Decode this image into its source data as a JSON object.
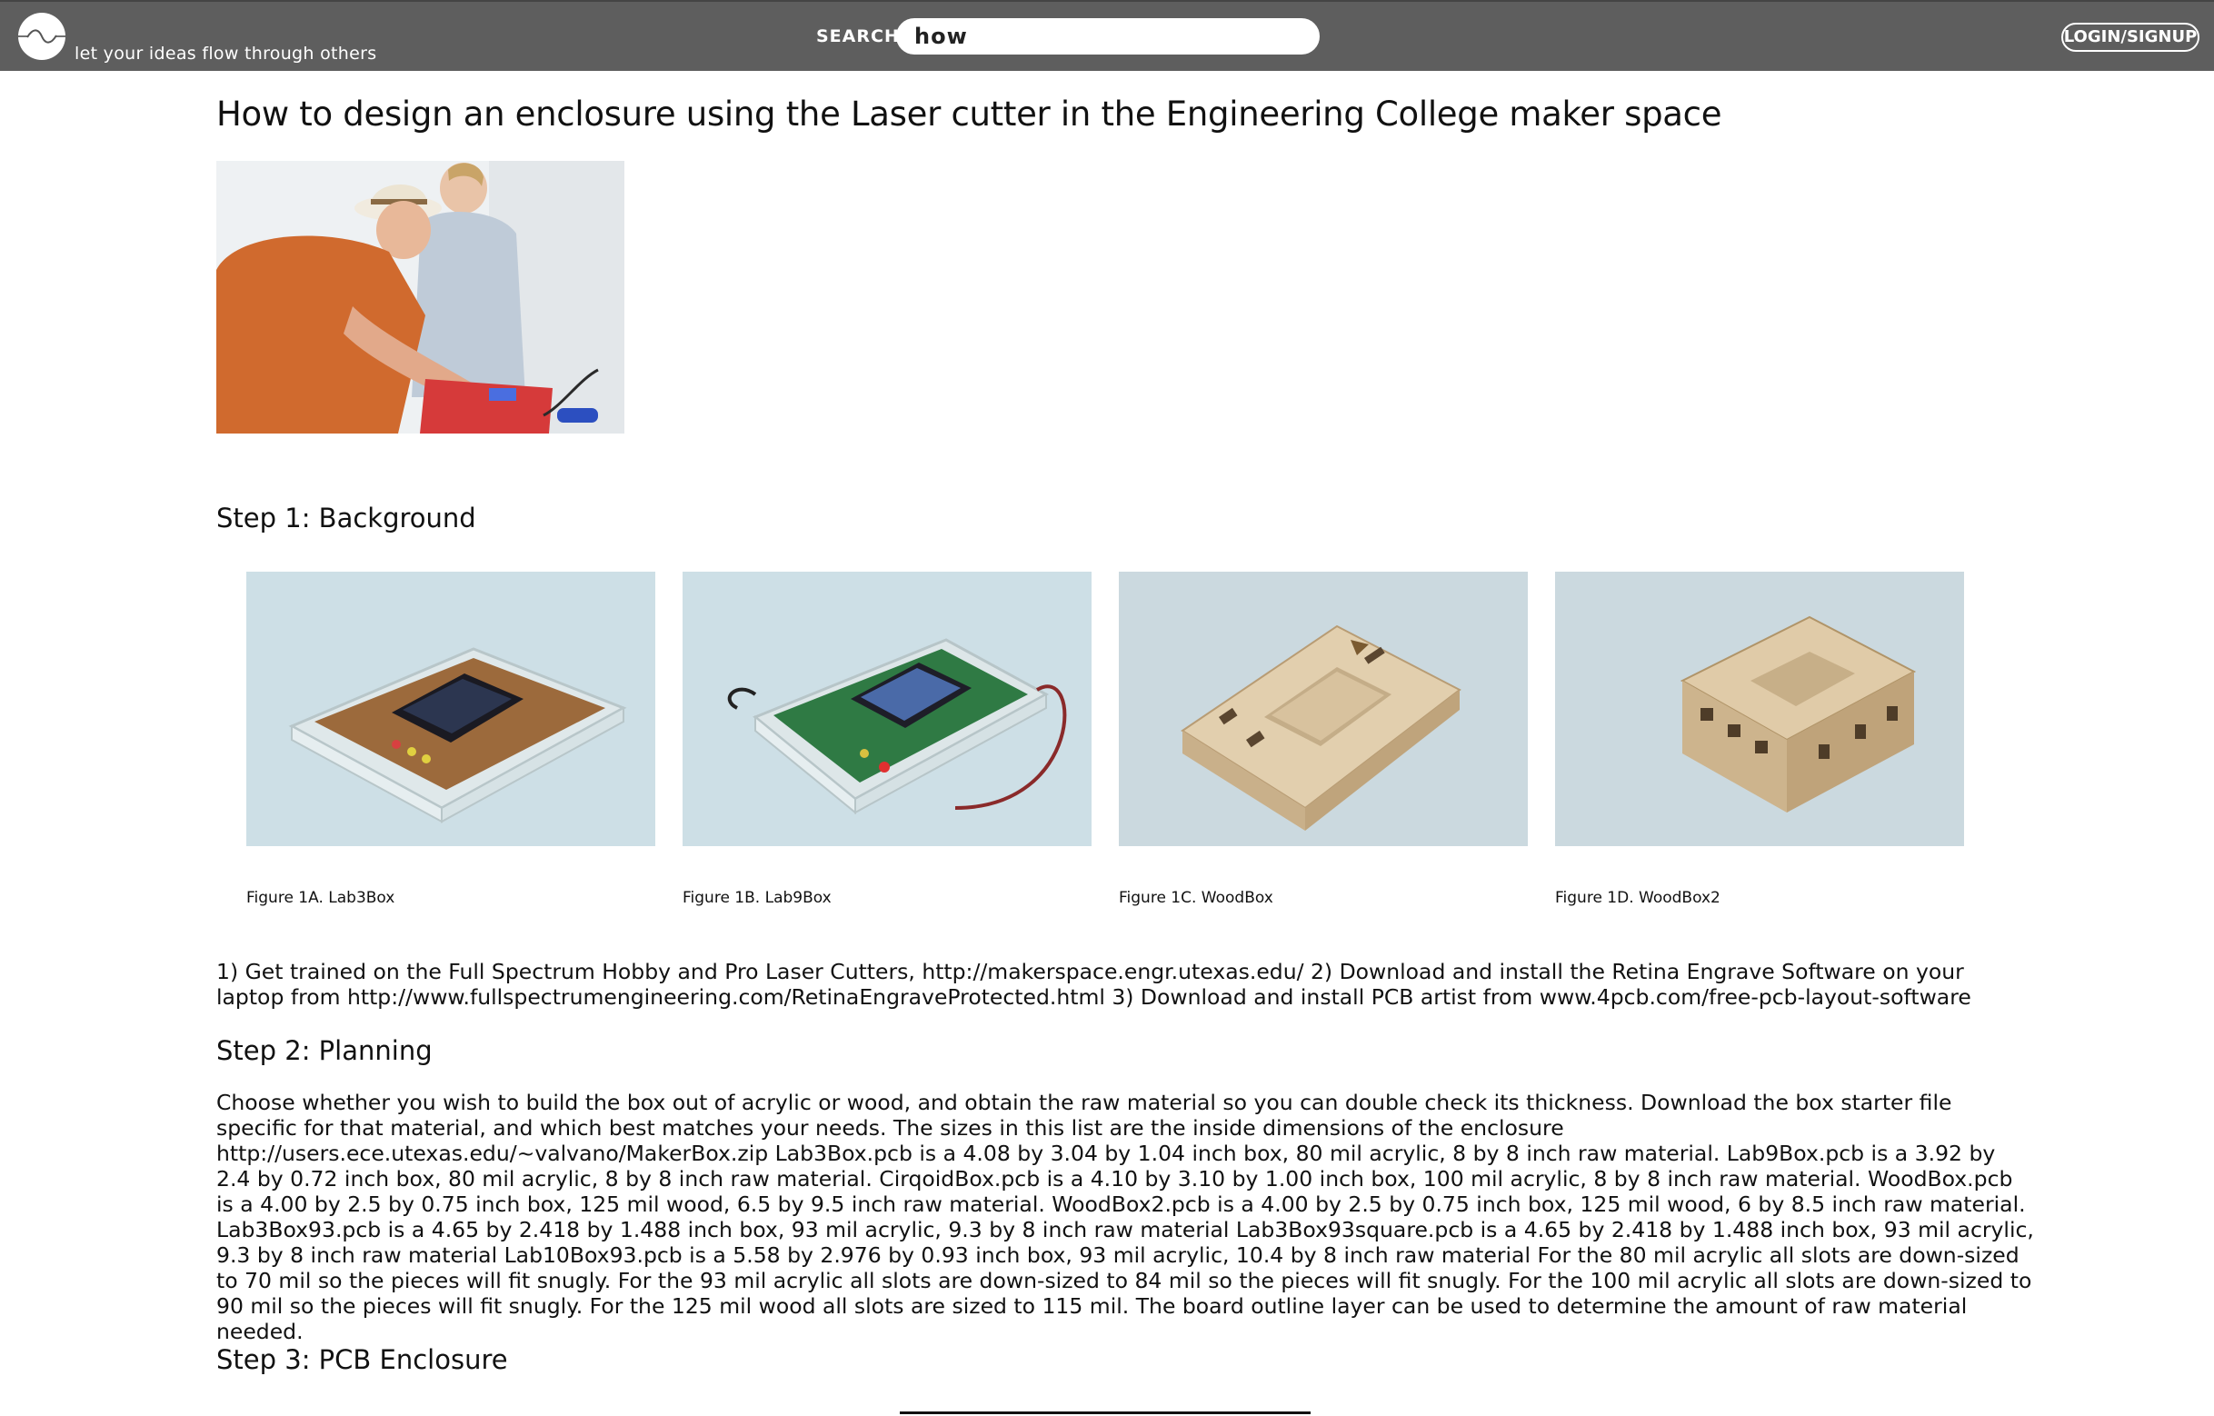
{
  "header": {
    "tagline": "let your ideas flow through others",
    "search_label": "SEARCH",
    "search_value": "how",
    "login_label": "LOGIN/SIGNUP"
  },
  "article": {
    "title": "How to design an enclosure using the Laser cutter in the Engineering College maker space",
    "steps": [
      {
        "heading": "Step 1: Background",
        "figures": [
          {
            "caption": "Figure 1A. Lab3Box"
          },
          {
            "caption": "Figure 1B. Lab9Box"
          },
          {
            "caption": "Figure 1C. WoodBox"
          },
          {
            "caption": "Figure 1D. WoodBox2"
          }
        ],
        "body": "1) Get trained on the Full Spectrum Hobby and Pro Laser Cutters, http://makerspace.engr.utexas.edu/ 2) Download and install the Retina Engrave Software on your laptop from http://www.fullspectrumengineering.com/RetinaEngraveProtected.html 3) Download and install PCB artist from www.4pcb.com/free-pcb-layout-software"
      },
      {
        "heading": "Step 2: Planning",
        "body": "Choose whether you wish to build the box out of acrylic or wood, and obtain the raw material so you can double check its thickness. Download the box starter file specific for that material, and which best matches your needs. The sizes in this list are the inside dimensions of the enclosure http://users.ece.utexas.edu/~valvano/MakerBox.zip Lab3Box.pcb is a 4.08 by 3.04 by 1.04 inch box, 80 mil acrylic, 8 by 8 inch raw material. Lab9Box.pcb is a 3.92 by 2.4 by 0.72 inch box, 80 mil acrylic, 8 by 8 inch raw material. CirqoidBox.pcb is a 4.10 by 3.10 by 1.00 inch box, 100 mil acrylic, 8 by 8 inch raw material. WoodBox.pcb is a 4.00 by 2.5 by 0.75 inch box, 125 mil wood, 6.5 by 9.5 inch raw material. WoodBox2.pcb is a 4.00 by 2.5 by 0.75 inch box, 125 mil wood, 6 by 8.5 inch raw material. Lab3Box93.pcb is a 4.65 by 2.418 by 1.488 inch box, 93 mil acrylic, 9.3 by 8 inch raw material Lab3Box93square.pcb is a 4.65 by 2.418 by 1.488 inch box, 93 mil acrylic, 9.3 by 8 inch raw material Lab10Box93.pcb is a 5.58 by 2.976 by 0.93 inch box, 93 mil acrylic, 10.4 by 8 inch raw material For the 80 mil acrylic all slots are down-sized to 70 mil so the pieces will fit snugly. For the 93 mil acrylic all slots are down-sized to 84 mil so the pieces will fit snugly. For the 100 mil acrylic all slots are down-sized to 90 mil so the pieces will fit snugly. For the 125 mil wood all slots are sized to 115 mil. The board outline layer can be used to determine the amount of raw material needed."
      },
      {
        "heading": "Step 3: PCB Enclosure"
      }
    ]
  },
  "colors": {
    "header_bg": "#5e5e5e",
    "text": "#111111"
  }
}
